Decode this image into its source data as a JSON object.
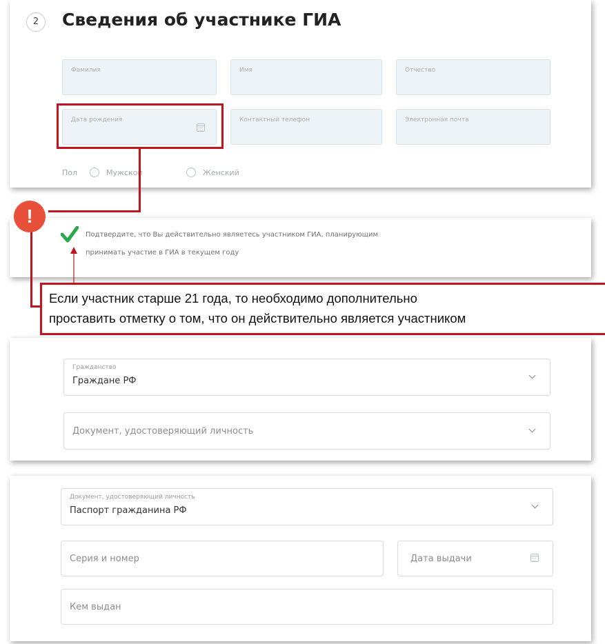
{
  "section": {
    "number": "2",
    "title": "Сведения об участнике ГИА"
  },
  "personal_fields": [
    {
      "label": "Фамилия"
    },
    {
      "label": "Имя"
    },
    {
      "label": "Отчество"
    },
    {
      "label": "Дата рождения"
    },
    {
      "label": "Контактный телефон"
    },
    {
      "label": "Электронная почта"
    }
  ],
  "gender": {
    "label": "Пол",
    "options": [
      "Мужской",
      "Женский"
    ]
  },
  "confirmation": {
    "line1": "Подтвердите, что Вы действительно являетесь участником ГИА, планирующим",
    "line2": "принимать участие в ГИА в текущем году"
  },
  "callout": {
    "badge": "!",
    "line1": "Если участник старше 21 года, то необходимо дополнительно",
    "line2": "проставить отметку о том, что он действительно является участником"
  },
  "citizenship": {
    "label": "Гражданство",
    "value": "Граждане РФ"
  },
  "id_document_select": {
    "placeholder": "Документ, удостоверяющий личность"
  },
  "document": {
    "type_label": "Документ, удостоверяющий личность",
    "type_value": "Паспорт гражданина РФ",
    "series_placeholder": "Серия и номер",
    "issue_date_placeholder": "Дата выдачи",
    "issued_by_placeholder": "Кем выдан"
  },
  "colors": {
    "highlight": "#c0141e",
    "badge": "#e8503a",
    "check": "#2aa84a",
    "field_bg": "#eef3f8"
  }
}
